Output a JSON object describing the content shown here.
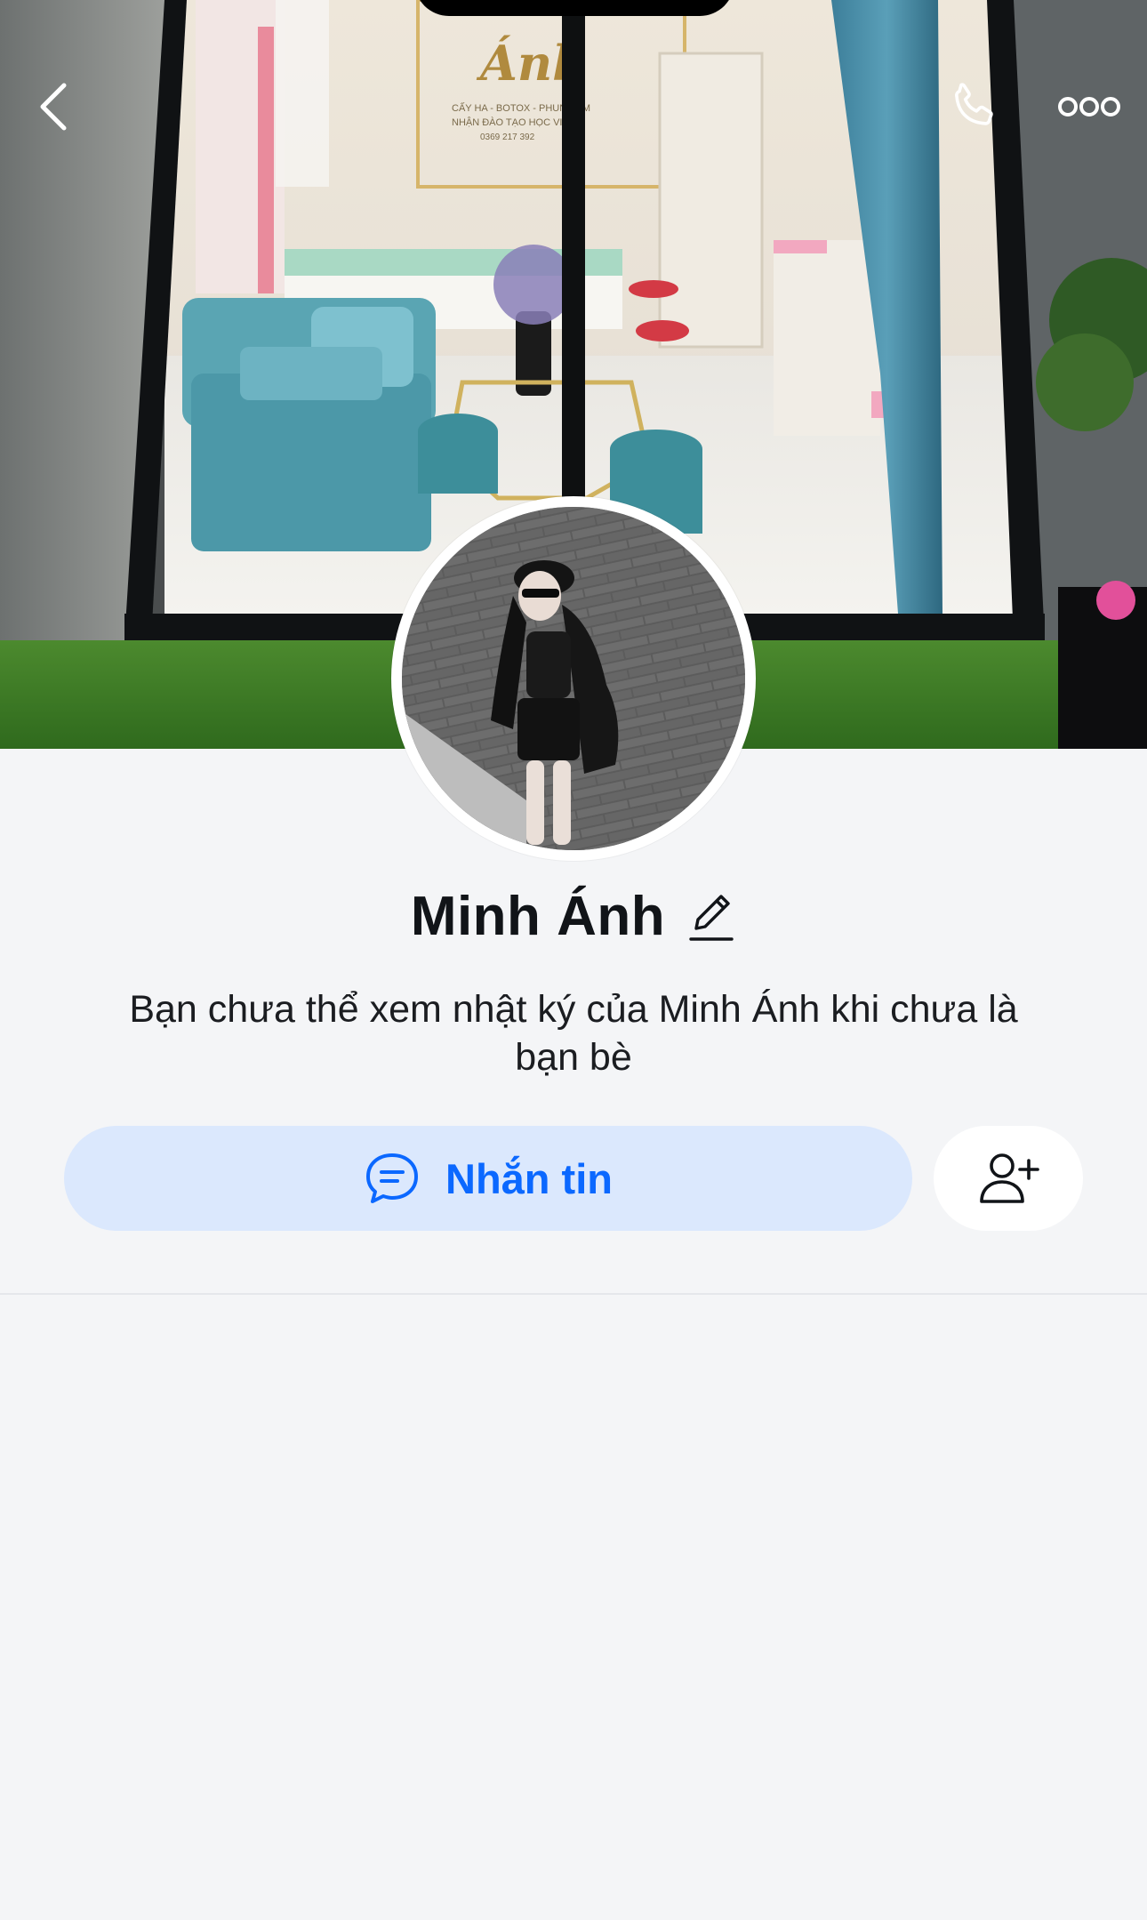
{
  "profile": {
    "name": "Minh Ánh",
    "notice": "Bạn chưa thể xem nhật ký của Minh Ánh khi chưa là bạn bè"
  },
  "cover": {
    "sign_brand": "Ánh",
    "sign_line1": "CẤY HA - BOTOX - PHUN XĂM",
    "sign_line2": "NHẬN ĐÀO TẠO HỌC VIÊN",
    "sign_phone": "0369 217 392"
  },
  "actions": {
    "message_label": "Nhắn tin"
  },
  "icons": {
    "back": "chevron-left-icon",
    "call": "phone-icon",
    "more": "more-dots-icon",
    "edit": "pencil-icon",
    "chat": "chat-bubble-icon",
    "add_friend": "add-user-icon"
  },
  "colors": {
    "accent": "#0b68ff",
    "message_button_bg": "#dbe8fd",
    "page_bg": "#f4f5f7"
  }
}
